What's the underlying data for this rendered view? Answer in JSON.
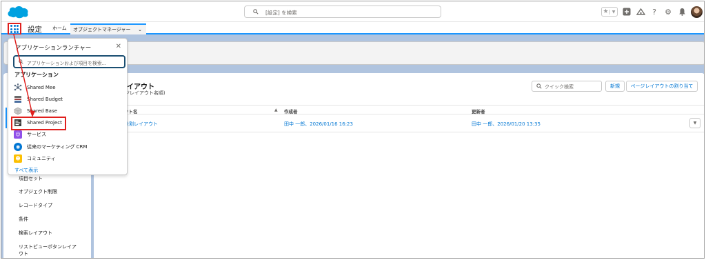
{
  "header": {
    "search_placeholder": "[設定] を検索"
  },
  "nav": {
    "app_title": "設定",
    "tabs": [
      {
        "label": "ホーム"
      },
      {
        "label": "オブジェクトマネージャー"
      }
    ]
  },
  "launcher": {
    "title": "アプリケーションランチャー",
    "search_placeholder": "アプリケーションおよび項目を検索...",
    "section_title": "アプリケーション",
    "apps": [
      {
        "label": "Shared Mee",
        "icon": "network-icon",
        "color": "#5a6b80"
      },
      {
        "label": "Shared Budget",
        "icon": "budget-icon",
        "color": "#6b6b6b"
      },
      {
        "label": "Shared Base",
        "icon": "box-icon",
        "color": "#b8b8b8"
      },
      {
        "label": "Shared Project",
        "icon": "project-icon",
        "color": "#3a3a3a"
      },
      {
        "label": "サービス",
        "icon": "chat-icon",
        "color": "#9050e9"
      },
      {
        "label": "従来のマーケティング CRM",
        "icon": "location-icon",
        "color": "#0176d3"
      },
      {
        "label": "コミュニティ",
        "icon": "community-icon",
        "color": "#fcc003"
      }
    ],
    "view_all": "すべて表示"
  },
  "sidebar": {
    "items": [
      {
        "label": "項目セット"
      },
      {
        "label": "オブジェクト制限"
      },
      {
        "label": "レコードタイプ"
      },
      {
        "label": "条件"
      },
      {
        "label": "検索レイアウト"
      },
      {
        "label": "リストビューボタンレイア"
      },
      {
        "label": "ウト"
      }
    ]
  },
  "main": {
    "title": "レイアウト",
    "subtitle": "ージレイアウト名順)",
    "quick_search_placeholder": "クイック検索",
    "new_button": "新規",
    "assign_button": "ページレイアウトの割り当て",
    "columns": [
      "ウト名",
      "作成者",
      "更新者"
    ],
    "sort_indicator": "▲",
    "rows": [
      {
        "name": "役割レイアウト",
        "created_by": "田中 一郎、2026/01/16 16:23",
        "modified_by": "田中 一郎、2026/01/20 13:35"
      }
    ]
  },
  "colors": {
    "accent": "#0176d3",
    "highlight": "#e0201e",
    "background": "#b0c4df"
  }
}
